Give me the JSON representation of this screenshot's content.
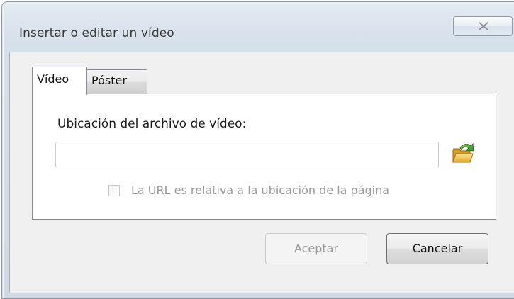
{
  "dialog": {
    "title": "Insertar o editar un vídeo"
  },
  "tabs": [
    {
      "label": "Vídeo",
      "active": true
    },
    {
      "label": "Póster",
      "active": false
    }
  ],
  "video_tab": {
    "location_label": "Ubicación del archivo de vídeo:",
    "location_value": "",
    "relative_url_label": "La URL es relativa a la ubicación de la página",
    "relative_url_checked": false,
    "relative_url_enabled": false
  },
  "buttons": {
    "accept_label": "Aceptar",
    "accept_enabled": false,
    "cancel_label": "Cancelar"
  },
  "icons": {
    "close": "close-icon",
    "browse": "folder-browse-icon"
  },
  "colors": {
    "frame": "#dce5ef",
    "client": "#f0f0f0",
    "disabled_text": "#9a9a9a",
    "folder_yellow": "#f2c74e",
    "arrow_green": "#3f9f2a"
  }
}
